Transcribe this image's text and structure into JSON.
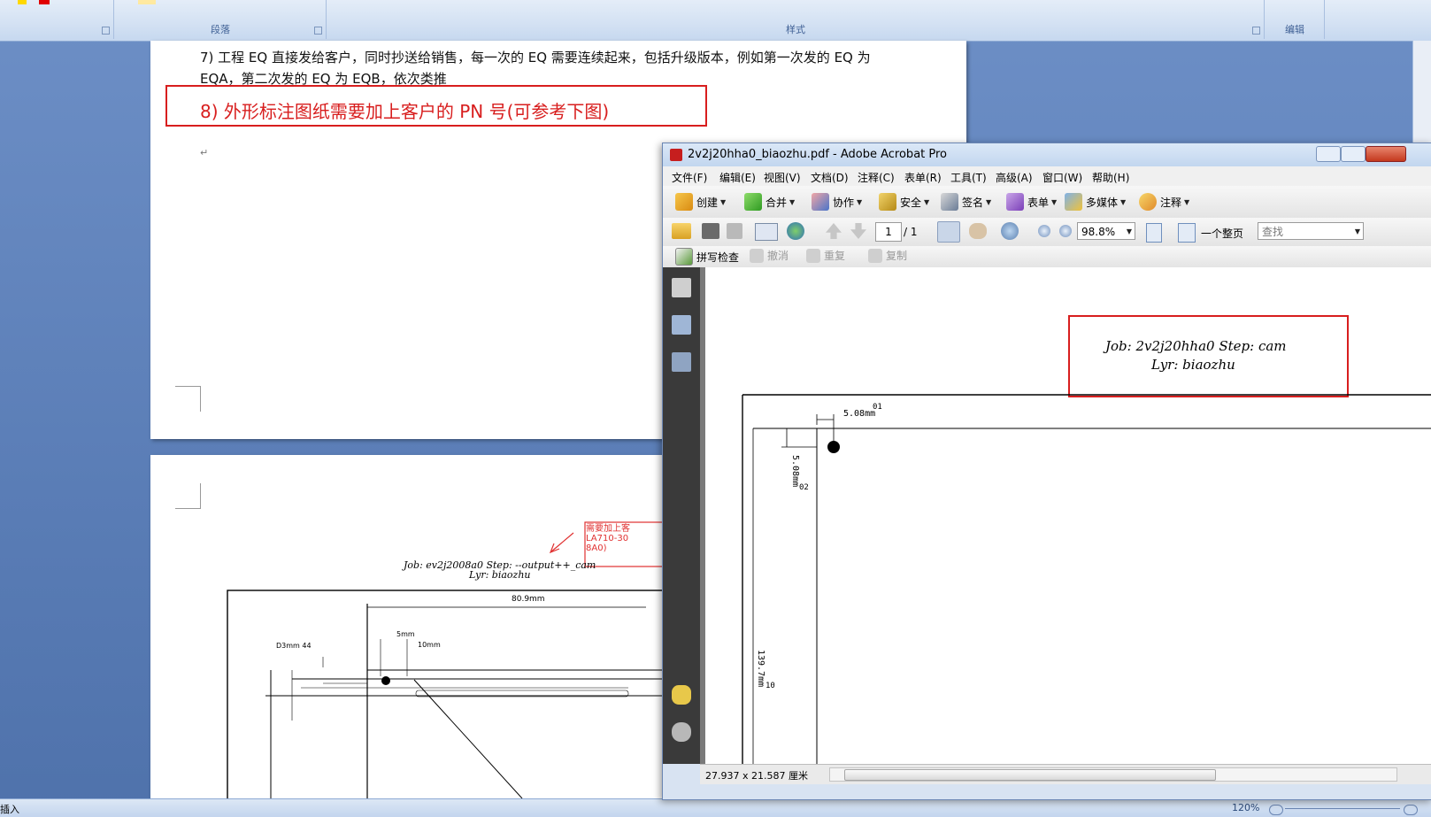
{
  "word": {
    "ribbon": {
      "groups": [
        {
          "label": "段落"
        },
        {
          "label": "样式"
        },
        {
          "label": "编辑"
        }
      ]
    },
    "doc": {
      "line7a": "7)  工程 EQ 直接发给客户，同时抄送给销售，每一次的 EQ 需要连续起来，包括升级版本，例如第一次发的 EQ 为",
      "line7b": "EQA，第二次发的 EQ 为 EQB，依次类推",
      "line8": "8)  外形标注图纸需要加上客户的 PN 号(可参考下图)",
      "paragraph_mark": "↵"
    },
    "drawing": {
      "job_line": "Job: ev2j2008a0  Step: --output++_cam",
      "lyr_line": "Lyr: biaozhu",
      "note_lines": [
        "需要加上客",
        "LA710-30",
        "8A0)"
      ],
      "dim_top": "80.9mm",
      "dim_a": "5mm",
      "dim_b": "10mm",
      "dim_c": "D3mm 44"
    },
    "status": {
      "mode": "插入",
      "zoom": "120%"
    }
  },
  "acrobat": {
    "title": "2v2j20hha0_biaozhu.pdf - Adobe Acrobat Pro",
    "menu": [
      "文件(F)",
      "编辑(E)",
      "视图(V)",
      "文档(D)",
      "注释(C)",
      "表单(R)",
      "工具(T)",
      "高级(A)",
      "窗口(W)",
      "帮助(H)"
    ],
    "toolbar1": [
      "创建",
      "合并",
      "协作",
      "安全",
      "签名",
      "表单",
      "多媒体",
      "注释"
    ],
    "page_current": "1",
    "page_total": "/ 1",
    "zoom": "98.8%",
    "fit_label": "一个整页",
    "search_placeholder": "查找",
    "toolbar3": [
      "拼写检查",
      "撤消",
      "重复",
      "复制"
    ],
    "page_size": "27.937 x 21.587 厘米",
    "pdf": {
      "job_line": "Job: 2v2j20hha0  Step: cam",
      "lyr_line": "Lyr: biaozhu",
      "dim_h": "5.08mm",
      "label_01": "01",
      "dim_v": "5.08mm",
      "label_02": "02",
      "dim_long": "139.7mm",
      "label_10": "10"
    }
  }
}
